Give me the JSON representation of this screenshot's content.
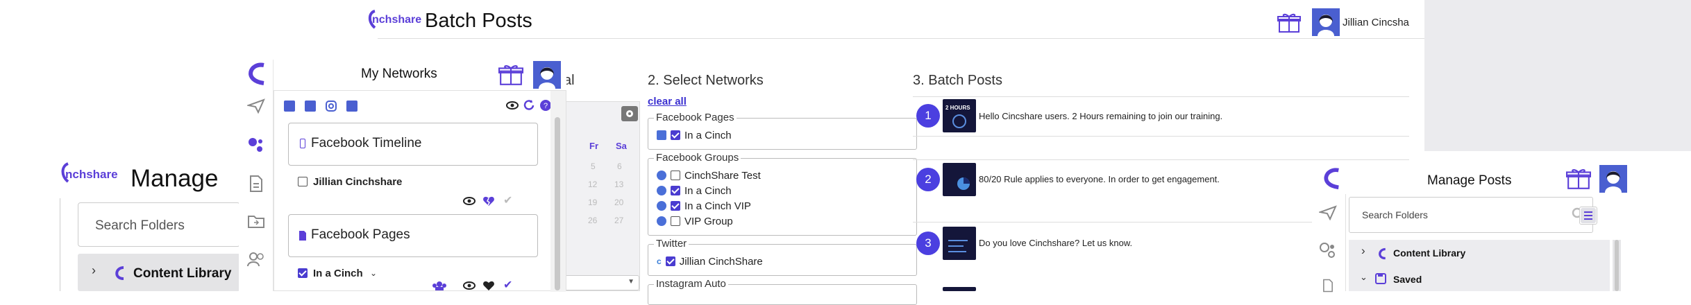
{
  "batch": {
    "logo_text": "nchshare",
    "title": "Batch Posts",
    "user_name": "Jillian Cincsha",
    "step1_title_fragment": "al",
    "step2_title": "2. Select Networks",
    "clear_all": "clear all",
    "calendar_days": [
      "Fr",
      "Sa"
    ],
    "calendar_rows": [
      [
        "5",
        "6"
      ],
      [
        "12",
        "13"
      ],
      [
        "19",
        "20"
      ],
      [
        "26",
        "27"
      ]
    ],
    "fb_pages_legend": "Facebook Pages",
    "fb_pages_items": [
      {
        "label": "In a Cinch",
        "checked": true
      }
    ],
    "fb_groups_legend": "Facebook Groups",
    "fb_groups_items": [
      {
        "label": "CinchShare Test",
        "checked": false
      },
      {
        "label": "In a Cinch",
        "checked": true
      },
      {
        "label": "In a Cinch VIP",
        "checked": true
      },
      {
        "label": "VIP Group",
        "checked": false
      }
    ],
    "twitter_legend": "Twitter",
    "twitter_items": [
      {
        "label": "Jillian CinchShare",
        "checked": true
      }
    ],
    "instagram_legend": "Instagram Auto",
    "step3_title": "3. Batch Posts",
    "posts": [
      {
        "num": "1",
        "text": "Hello Cincshare users. 2 Hours remaining to join our training."
      },
      {
        "num": "2",
        "text": "80/20 Rule applies to everyone. In order to get engagement."
      },
      {
        "num": "3",
        "text": "Do you love Cinchshare? Let us know."
      }
    ],
    "thumb1_text": "2 HOURS"
  },
  "networks": {
    "title": "My Networks",
    "fb_timeline_label": "Facebook Timeline",
    "fb_timeline_account": "Jillian Cinchshare",
    "fb_pages_label": "Facebook Pages",
    "fb_pages_account": "In a Cinch"
  },
  "manage_left": {
    "logo_text": "nchshare",
    "title": "Manage",
    "search_placeholder": "Search Folders",
    "folder": "Content Library"
  },
  "manage_right": {
    "title": "Manage Posts",
    "search_placeholder": "Search Folders",
    "folders": [
      "Content Library",
      "Saved"
    ]
  },
  "colors": {
    "accent": "#5b3fd8",
    "badge": "#4b3fe0"
  }
}
